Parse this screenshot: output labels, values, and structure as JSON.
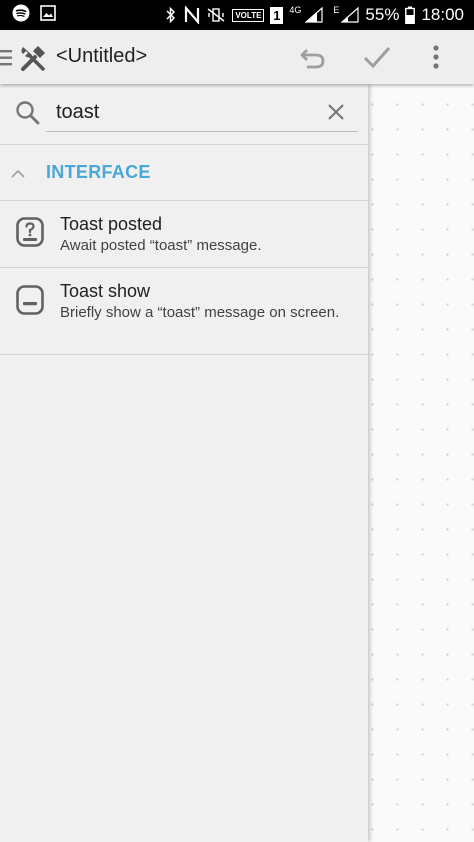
{
  "status_bar": {
    "battery_text": "55%",
    "time": "18:00",
    "network_4g": "4G",
    "network_e": "E",
    "volte_label": "VOLTE",
    "sim_label": "1",
    "icons": [
      "spotify-icon",
      "gallery-icon",
      "bluetooth-icon",
      "nfc-icon",
      "vibrate-icon",
      "volte-icon",
      "sim-icon",
      "signal-icon",
      "battery-icon"
    ]
  },
  "toolbar": {
    "title": "<Untitled>",
    "icons": [
      "menu-icon",
      "tools-icon",
      "undo-icon",
      "check-icon",
      "more-vert-icon"
    ]
  },
  "search": {
    "value": "toast"
  },
  "section": {
    "title": "INTERFACE"
  },
  "items": [
    {
      "title": "Toast posted",
      "description": "Await posted “toast” message.",
      "icon": "toast-question-icon"
    },
    {
      "title": "Toast show",
      "description": "Briefly show a “toast” message on screen.",
      "icon": "toast-show-icon"
    }
  ],
  "colors": {
    "accent": "#4aa8d8",
    "toolbar_bg": "#eeeeee",
    "panel_bg": "#f0f0f0",
    "status_bg": "#000000"
  }
}
